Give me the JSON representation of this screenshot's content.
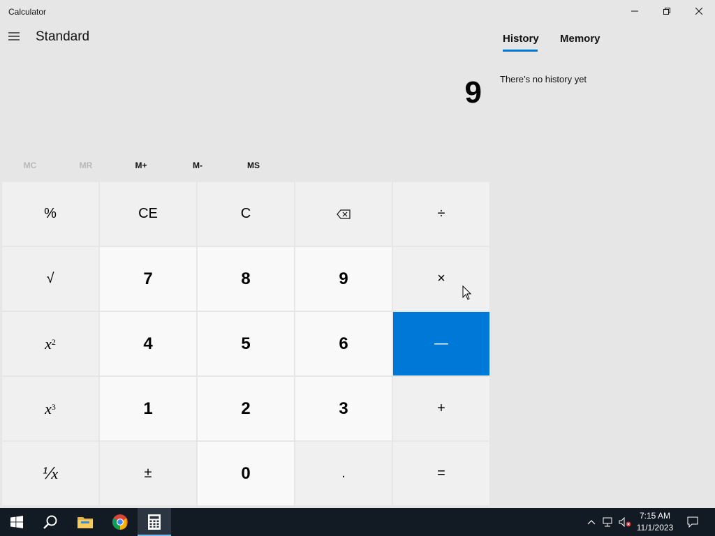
{
  "window": {
    "title": "Calculator"
  },
  "header": {
    "mode": "Standard"
  },
  "display": {
    "value": "9"
  },
  "memory": [
    {
      "label": "MC",
      "enabled": false
    },
    {
      "label": "MR",
      "enabled": false
    },
    {
      "label": "M+",
      "enabled": true
    },
    {
      "label": "M-",
      "enabled": true
    },
    {
      "label": "MS",
      "enabled": true
    }
  ],
  "keys": {
    "percent": "%",
    "ce": "CE",
    "c": "C",
    "divide": "÷",
    "sqrt": "√",
    "seven": "7",
    "eight": "8",
    "nine": "9",
    "multiply": "×",
    "x_var": "x",
    "square_exp": "2",
    "four": "4",
    "five": "5",
    "six": "6",
    "minus": "—",
    "cube_exp": "3",
    "one": "1",
    "two": "2",
    "three": "3",
    "plus": "+",
    "reciprocal": "⅟x",
    "negate": "±",
    "zero": "0",
    "decimal": ".",
    "equals": "="
  },
  "panel": {
    "tabs": [
      "History",
      "Memory"
    ],
    "active_tab": "History",
    "empty_message": "There’s no history yet"
  },
  "taskbar": {
    "time": "7:15 AM",
    "date": "11/1/2023",
    "pinned": [
      "start-icon",
      "search-icon",
      "file-explorer-icon",
      "chrome-icon",
      "calculator-icon"
    ]
  },
  "colors": {
    "accent": "#0078d7",
    "background": "#e6e6e6",
    "taskbar": "#121a24"
  }
}
